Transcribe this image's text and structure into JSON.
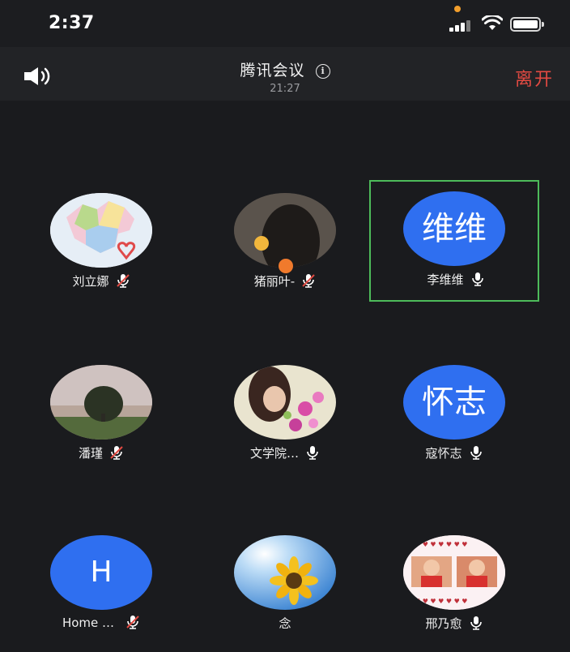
{
  "status_bar": {
    "time": "2:37"
  },
  "header": {
    "title": "腾讯会议",
    "subtitle_time": "21:27",
    "leave_label": "离开"
  },
  "participants": [
    {
      "name": "刘立娜",
      "avatar_type": "photo",
      "avatar_desc": "map",
      "mic": "muted"
    },
    {
      "name": "猪丽叶-",
      "avatar_type": "photo",
      "avatar_desc": "person-silhouette",
      "mic": "muted",
      "badge": "host-icon"
    },
    {
      "name": "李维维",
      "avatar_type": "text",
      "avatar_text": "维维",
      "mic": "on",
      "active": true
    },
    {
      "name": "潘瑾",
      "avatar_type": "photo",
      "avatar_desc": "tree-landscape",
      "mic": "muted"
    },
    {
      "name": "文学院…",
      "avatar_type": "photo",
      "avatar_desc": "person-with-flowers",
      "mic": "on"
    },
    {
      "name": "寇怀志",
      "avatar_type": "text",
      "avatar_text": "怀志",
      "mic": "on"
    },
    {
      "name": "Home …",
      "avatar_type": "text",
      "avatar_text": "H",
      "mic": "muted"
    },
    {
      "name": "念",
      "avatar_type": "photo",
      "avatar_desc": "sunflower",
      "mic": "none"
    },
    {
      "name": "邢乃愈",
      "avatar_type": "photo",
      "avatar_desc": "baby-photos",
      "mic": "on"
    }
  ],
  "colors": {
    "accent_blue": "#2f6ff0",
    "leave_red": "#e24a42",
    "active_border": "#4dbb5a"
  }
}
